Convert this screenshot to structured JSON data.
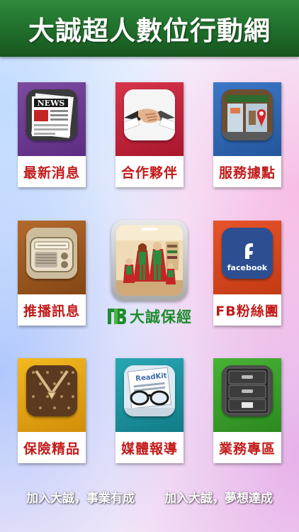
{
  "header": {
    "title": "大誠超人數位行動網"
  },
  "tiles": [
    {
      "label": "最新消息",
      "icon": "newspaper-icon"
    },
    {
      "label": "合作夥伴",
      "icon": "handshake-icon"
    },
    {
      "label": "服務據點",
      "icon": "storefront-map-pin-icon"
    },
    {
      "label": "推播訊息",
      "icon": "radio-icon"
    },
    {
      "label": "FB粉絲團",
      "icon": "facebook-icon",
      "icon_text": "facebook"
    },
    {
      "label": "保險精品",
      "icon": "luxury-bag-icon"
    },
    {
      "label": "媒體報導",
      "icon": "glasses-newspaper-icon",
      "icon_text": "ReadKit"
    },
    {
      "label": "業務專區",
      "icon": "filing-cabinet-icon"
    }
  ],
  "featured": {
    "brand_name": "大誠保經",
    "logo": "tb-logo-icon",
    "image": "superhero-family-icon"
  },
  "footer": {
    "left": "加入大誠，事業有成",
    "right": "加入大誠，夢想達成"
  },
  "colors": {
    "header_green": "#1f6d2b",
    "label_red": "#c31a1a",
    "brand_green": "#1f8c2f",
    "facebook_blue": "#2d4f92"
  }
}
